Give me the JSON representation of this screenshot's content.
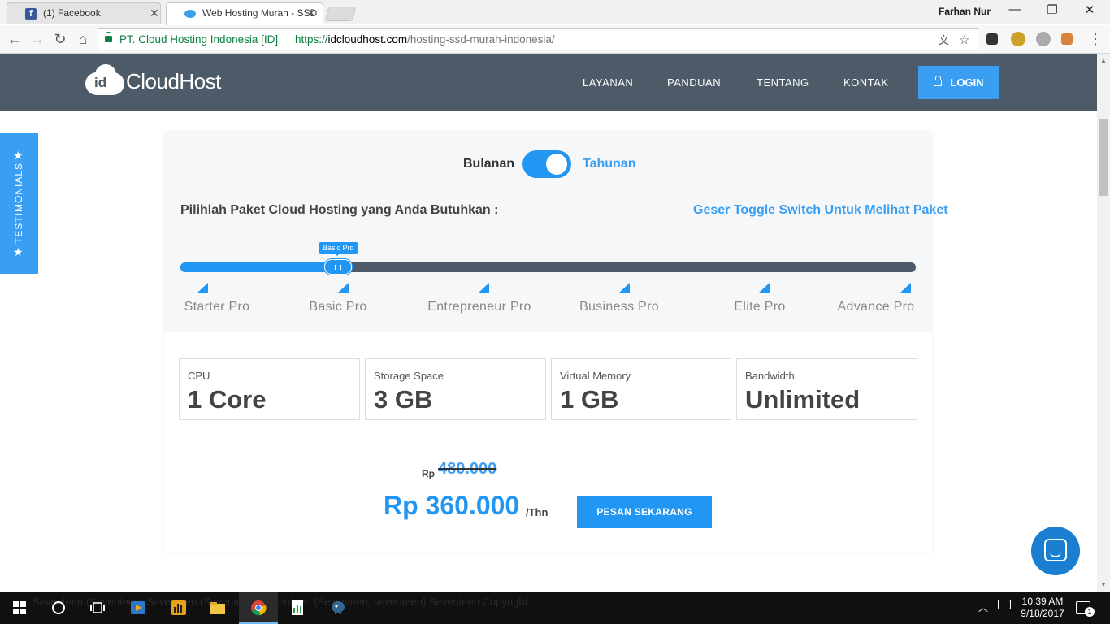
{
  "browser": {
    "tabs": [
      {
        "title": "(1) Facebook",
        "favicon": "facebook-icon",
        "active": false
      },
      {
        "title": "Web Hosting Murah - SSD",
        "favicon": "cloud-icon",
        "active": true
      }
    ],
    "user": "Farhan Nur",
    "window_controls": {
      "minimize": "—",
      "maximize": "❐",
      "close": "✕"
    },
    "nav": {
      "back": "←",
      "forward": "→",
      "reload": "↻",
      "home": "⌂"
    },
    "address": {
      "org": "PT. Cloud Hosting Indonesia [ID]",
      "scheme": "https://",
      "host": "idcloudhost.com",
      "path": "/hosting-ssd-murah-indonesia/"
    },
    "omnibox_icons": {
      "translate": "文",
      "bookmark": "☆"
    },
    "menu_icon": "⋮"
  },
  "site": {
    "logo": {
      "mark": "id",
      "name": "CloudHost"
    },
    "menu": [
      "LAYANAN",
      "PANDUAN",
      "TENTANG",
      "KONTAK"
    ],
    "login_label": "LOGIN",
    "testimonials_label": "TESTIMONIALS",
    "star": "★"
  },
  "pricing": {
    "billing_toggle": {
      "left_label": "Bulanan",
      "right_label": "Tahunan",
      "selected": "Tahunan"
    },
    "prompt": "Pilihlah Paket Cloud Hosting yang Anda Butuhkan :",
    "hint": "Geser Toggle Switch Untuk Melihat Paket",
    "slider": {
      "selected_index": 1,
      "tooltip": "Basic Pro"
    },
    "plans": [
      "Starter Pro",
      "Basic Pro",
      "Entrepreneur Pro",
      "Business Pro",
      "Elite Pro",
      "Advance Pro"
    ],
    "specs": [
      {
        "label": "CPU",
        "value": "1 Core"
      },
      {
        "label": "Storage Space",
        "value": "3 GB"
      },
      {
        "label": "Virtual Memory",
        "value": "1 GB"
      },
      {
        "label": "Bandwidth",
        "value": "Unlimited"
      }
    ],
    "old_price": {
      "currency": "Rp",
      "amount": "480.000"
    },
    "new_price": {
      "text": "Rp 360.000",
      "period": "/Thn"
    },
    "order_label": "PESAN SEKARANG"
  },
  "taskbar": {
    "marquee": "Seventeen (Seventeen) Seventeen (Seventeen) Seventeen (Seventeen, seventeen)   Seventeen   Copyright",
    "time": "10:39 AM",
    "date": "9/18/2017",
    "notification_count": "1"
  },
  "colors": {
    "accent": "#2196f3",
    "header": "#4d5a67",
    "card": "#f5f7f9"
  }
}
